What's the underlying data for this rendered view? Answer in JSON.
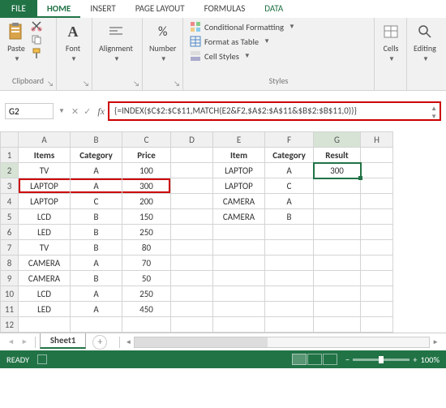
{
  "menu": {
    "file": "FILE",
    "tabs": [
      "HOME",
      "INSERT",
      "PAGE LAYOUT",
      "FORMULAS",
      "DATA"
    ],
    "active": "HOME"
  },
  "ribbon": {
    "clipboard": {
      "label": "Clipboard",
      "paste": "Paste"
    },
    "font": {
      "label": "Font",
      "btn": "Font"
    },
    "alignment": {
      "label": "Alignment",
      "btn": "Alignment"
    },
    "number": {
      "label": "Number",
      "btn": "Number"
    },
    "styles": {
      "label": "Styles",
      "items": [
        "Conditional Formatting",
        "Format as Table",
        "Cell Styles"
      ]
    },
    "cells": {
      "label": "Cells",
      "btn": "Cells"
    },
    "editing": {
      "label": "Editing",
      "btn": "Editing"
    }
  },
  "namebox": "G2",
  "formula": "{=INDEX($C$2:$C$11,MATCH(E2&F2,$A$2:$A$11&$B$2:$B$11,0))}",
  "cols": [
    "A",
    "B",
    "C",
    "D",
    "E",
    "F",
    "G",
    "H"
  ],
  "rows": [
    "1",
    "2",
    "3",
    "4",
    "5",
    "6",
    "7",
    "8",
    "9",
    "10",
    "11",
    "12"
  ],
  "data": {
    "A1": "Items",
    "B1": "Category",
    "C1": "Price",
    "E1": "Item",
    "F1": "Category",
    "G1": "Result",
    "A2": "TV",
    "B2": "A",
    "C2": "100",
    "E2": "LAPTOP",
    "F2": "A",
    "G2": "300",
    "A3": "LAPTOP",
    "B3": "A",
    "C3": "300",
    "E3": "LAPTOP",
    "F3": "C",
    "A4": "LAPTOP",
    "B4": "C",
    "C4": "200",
    "E4": "CAMERA",
    "F4": "A",
    "A5": "LCD",
    "B5": "B",
    "C5": "150",
    "E5": "CAMERA",
    "F5": "B",
    "A6": "LED",
    "B6": "B",
    "C6": "250",
    "A7": "TV",
    "B7": "B",
    "C7": "80",
    "A8": "CAMERA",
    "B8": "A",
    "C8": "70",
    "A9": "CAMERA",
    "B9": "B",
    "C9": "50",
    "A10": "LCD",
    "B10": "A",
    "C10": "250",
    "A11": "LED",
    "B11": "A",
    "C11": "450"
  },
  "sheet": {
    "name": "Sheet1"
  },
  "status": {
    "ready": "READY",
    "zoom": "100%"
  }
}
